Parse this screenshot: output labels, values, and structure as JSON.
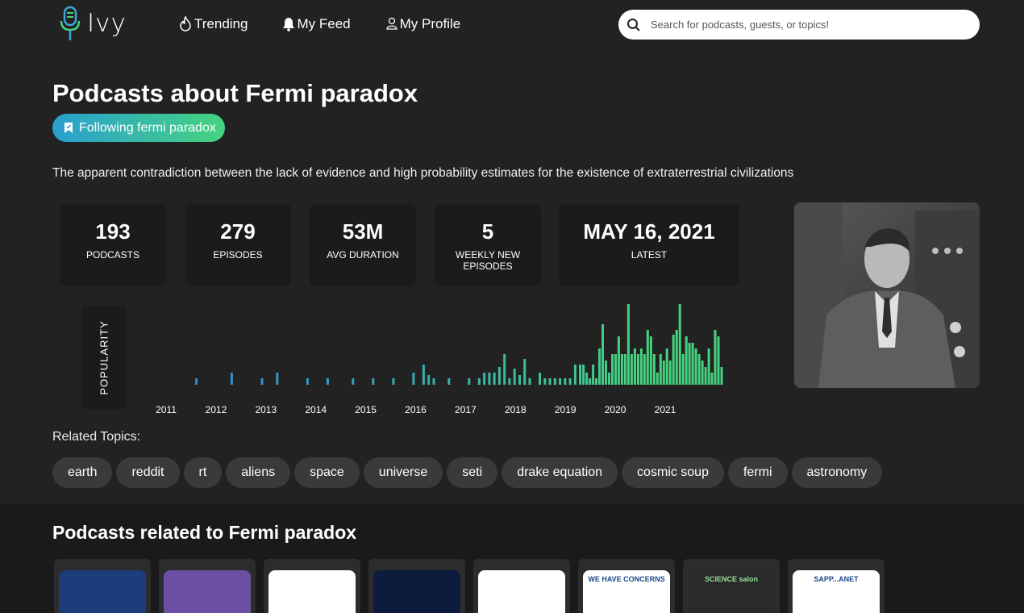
{
  "header": {
    "logo_text": "Ivy",
    "nav": [
      {
        "label": "Trending",
        "icon": "flame-icon"
      },
      {
        "label": "My Feed",
        "icon": "bell-icon"
      },
      {
        "label": "My Profile",
        "icon": "user-icon"
      }
    ],
    "search_placeholder": "Search for podcasts, guests, or topics!"
  },
  "topic": {
    "title": "Podcasts about Fermi paradox",
    "follow_label": "Following fermi paradox",
    "description": "The apparent contradiction between the lack of evidence and high probability estimates for the existence of extraterrestrial civilizations"
  },
  "stats": [
    {
      "value": "193",
      "label": "PODCASTS"
    },
    {
      "value": "279",
      "label": "EPISODES"
    },
    {
      "value": "53M",
      "label": "AVG DURATION"
    },
    {
      "value": "5",
      "label": "WEEKLY NEW EPISODES"
    },
    {
      "value": "MAY 16, 2021",
      "label": "LATEST"
    }
  ],
  "chart_data": {
    "type": "bar",
    "ylabel": "POPULARITY",
    "x_tick_labels": [
      "2011",
      "2012",
      "2013",
      "2014",
      "2015",
      "2016",
      "2017",
      "2018",
      "2019",
      "2020",
      "2021"
    ],
    "x_range": [
      2010.8,
      2021.8
    ],
    "ylim": [
      0,
      100
    ],
    "gradient_colors": [
      "#2a8ad8",
      "#46d37f"
    ],
    "points": [
      {
        "x": 2011.4,
        "y": 8
      },
      {
        "x": 2012.1,
        "y": 15
      },
      {
        "x": 2012.7,
        "y": 8
      },
      {
        "x": 2013.0,
        "y": 15
      },
      {
        "x": 2013.6,
        "y": 8
      },
      {
        "x": 2014.0,
        "y": 8
      },
      {
        "x": 2014.5,
        "y": 8
      },
      {
        "x": 2014.9,
        "y": 8
      },
      {
        "x": 2015.3,
        "y": 8
      },
      {
        "x": 2015.7,
        "y": 15
      },
      {
        "x": 2015.9,
        "y": 25
      },
      {
        "x": 2016.0,
        "y": 12
      },
      {
        "x": 2016.1,
        "y": 8
      },
      {
        "x": 2016.4,
        "y": 8
      },
      {
        "x": 2016.8,
        "y": 8
      },
      {
        "x": 2017.0,
        "y": 8
      },
      {
        "x": 2017.1,
        "y": 15
      },
      {
        "x": 2017.2,
        "y": 15
      },
      {
        "x": 2017.3,
        "y": 15
      },
      {
        "x": 2017.4,
        "y": 22
      },
      {
        "x": 2017.5,
        "y": 38
      },
      {
        "x": 2017.6,
        "y": 8
      },
      {
        "x": 2017.7,
        "y": 20
      },
      {
        "x": 2017.8,
        "y": 12
      },
      {
        "x": 2017.9,
        "y": 32
      },
      {
        "x": 2018.0,
        "y": 8
      },
      {
        "x": 2018.2,
        "y": 15
      },
      {
        "x": 2018.3,
        "y": 8
      },
      {
        "x": 2018.4,
        "y": 8
      },
      {
        "x": 2018.5,
        "y": 8
      },
      {
        "x": 2018.6,
        "y": 8
      },
      {
        "x": 2018.7,
        "y": 8
      },
      {
        "x": 2018.8,
        "y": 8
      },
      {
        "x": 2018.9,
        "y": 25
      },
      {
        "x": 2019.0,
        "y": 25
      },
      {
        "x": 2019.1,
        "y": 25
      },
      {
        "x": 2019.2,
        "y": 15
      },
      {
        "x": 2019.3,
        "y": 8
      },
      {
        "x": 2019.4,
        "y": 25
      },
      {
        "x": 2019.5,
        "y": 8
      },
      {
        "x": 2019.6,
        "y": 45
      },
      {
        "x": 2019.7,
        "y": 75
      },
      {
        "x": 2019.8,
        "y": 30
      },
      {
        "x": 2019.9,
        "y": 15
      },
      {
        "x": 2020.0,
        "y": 38
      },
      {
        "x": 2020.1,
        "y": 38
      },
      {
        "x": 2020.2,
        "y": 60
      },
      {
        "x": 2020.3,
        "y": 38
      },
      {
        "x": 2020.4,
        "y": 38
      },
      {
        "x": 2020.5,
        "y": 100
      },
      {
        "x": 2020.6,
        "y": 38
      },
      {
        "x": 2020.7,
        "y": 45
      },
      {
        "x": 2020.8,
        "y": 38
      },
      {
        "x": 2020.9,
        "y": 45
      },
      {
        "x": 2021.0,
        "y": 38
      },
      {
        "x": 2021.1,
        "y": 68
      },
      {
        "x": 2021.2,
        "y": 60
      },
      {
        "x": 2021.3,
        "y": 38
      },
      {
        "x": 2021.4,
        "y": 15
      },
      {
        "x": 2021.5,
        "y": 38
      },
      {
        "x": 2021.6,
        "y": 30
      },
      {
        "x": 2021.7,
        "y": 45
      },
      {
        "x": 2021.8,
        "y": 30
      },
      {
        "x": 2021.9,
        "y": 62
      },
      {
        "x": 2022.0,
        "y": 68
      },
      {
        "x": 2022.1,
        "y": 100
      },
      {
        "x": 2022.2,
        "y": 38
      },
      {
        "x": 2022.3,
        "y": 60
      },
      {
        "x": 2022.4,
        "y": 52
      },
      {
        "x": 2022.5,
        "y": 52
      },
      {
        "x": 2022.6,
        "y": 45
      },
      {
        "x": 2022.7,
        "y": 38
      },
      {
        "x": 2022.8,
        "y": 30
      },
      {
        "x": 2022.9,
        "y": 22
      },
      {
        "x": 2023.0,
        "y": 45
      },
      {
        "x": 2023.1,
        "y": 15
      },
      {
        "x": 2023.2,
        "y": 68
      },
      {
        "x": 2023.3,
        "y": 60
      },
      {
        "x": 2023.4,
        "y": 22
      }
    ]
  },
  "related_topics": {
    "label": "Related Topics:",
    "chips": [
      "earth",
      "reddit",
      "rt",
      "aliens",
      "space",
      "universe",
      "seti",
      "drake equation",
      "cosmic soup",
      "fermi",
      "astronomy"
    ]
  },
  "related_podcasts": {
    "title": "Podcasts related to Fermi paradox",
    "cards": [
      {
        "art": "man-portrait-icon",
        "color": "#1d3d7a"
      },
      {
        "art": "rocket-logo-icon",
        "color": "#6c4fa3"
      },
      {
        "art": "silhouette-logo-icon",
        "color": "#ffffff"
      },
      {
        "art": "man-portrait-icon",
        "color": "#0d1c3d"
      },
      {
        "art": "protest-logo-icon",
        "color": "#ffffff"
      },
      {
        "art": "we-have-concerns-logo-icon",
        "color": "#ffffff",
        "caption": "WE HAVE CONCERNS"
      },
      {
        "art": "science-salon-logo-icon",
        "color": "#2a2a2a",
        "caption": "SCIENCE salon"
      },
      {
        "art": "globe-logo-icon",
        "color": "#ffffff",
        "caption": "SAPP...ANET"
      }
    ]
  }
}
